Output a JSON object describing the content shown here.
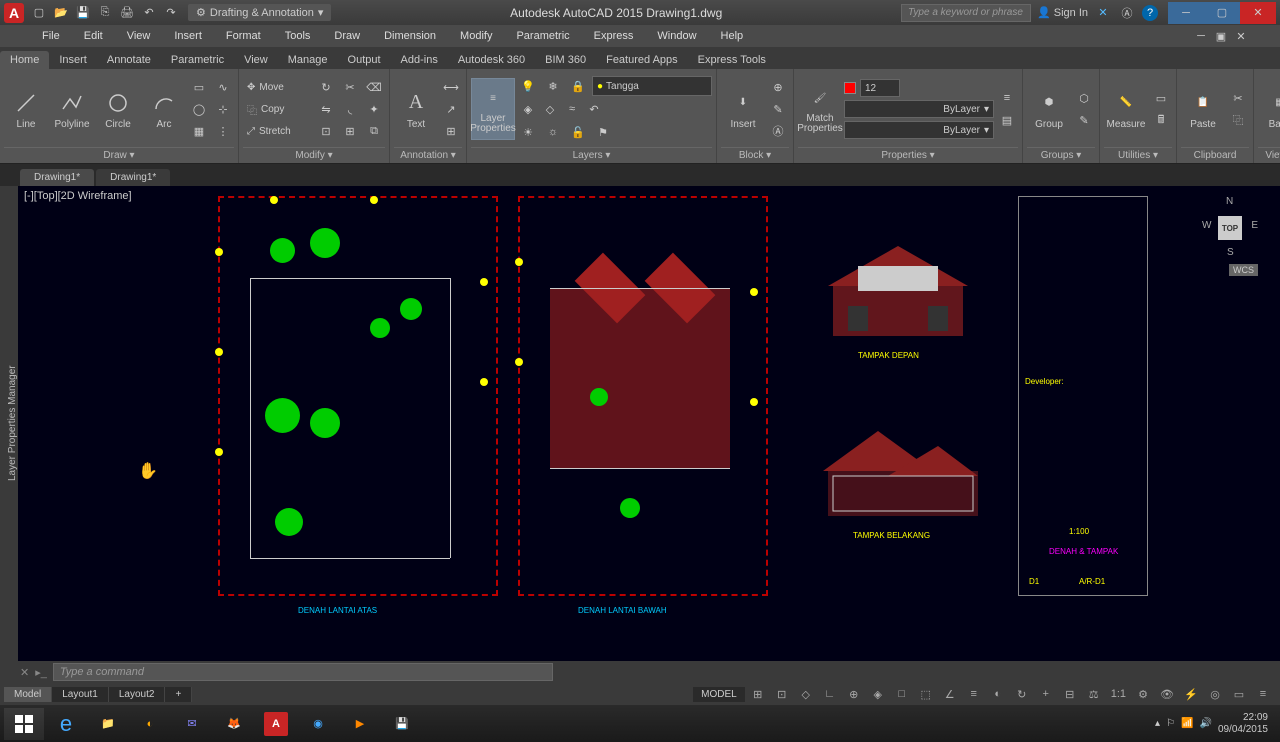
{
  "titlebar": {
    "workspace": "Drafting & Annotation",
    "app_title": "Autodesk AutoCAD 2015   Drawing1.dwg",
    "search_placeholder": "Type a keyword or phrase",
    "signin": "Sign In"
  },
  "menubar": [
    "File",
    "Edit",
    "View",
    "Insert",
    "Format",
    "Tools",
    "Draw",
    "Dimension",
    "Modify",
    "Parametric",
    "Express",
    "Window",
    "Help"
  ],
  "ribbon_tabs": [
    "Home",
    "Insert",
    "Annotate",
    "Parametric",
    "View",
    "Manage",
    "Output",
    "Add-ins",
    "Autodesk 360",
    "BIM 360",
    "Featured Apps",
    "Express Tools"
  ],
  "ribbon": {
    "draw": {
      "title": "Draw ▾",
      "line": "Line",
      "polyline": "Polyline",
      "circle": "Circle",
      "arc": "Arc"
    },
    "modify": {
      "title": "Modify ▾",
      "move": "Move",
      "copy": "Copy",
      "stretch": "Stretch"
    },
    "annotation": {
      "title": "Annotation ▾",
      "text": "Text"
    },
    "layers": {
      "title": "Layers ▾",
      "layerprops": "Layer Properties",
      "current": "Tangga"
    },
    "block": {
      "title": "Block ▾",
      "insert": "Insert"
    },
    "properties": {
      "title": "Properties ▾",
      "match": "Match Properties",
      "lineweight": "12",
      "bylayer1": "ByLayer",
      "bylayer2": "ByLayer"
    },
    "groups": {
      "title": "Groups ▾",
      "group": "Group"
    },
    "utilities": {
      "title": "Utilities ▾",
      "measure": "Measure"
    },
    "clipboard": {
      "title": "Clipboard",
      "paste": "Paste"
    },
    "view": {
      "title": "View ▾",
      "base": "Base"
    }
  },
  "doctabs": [
    "Drawing1*",
    "Drawing1*"
  ],
  "viewport": {
    "label": "[-][Top][2D Wireframe]",
    "cube": "TOP",
    "wcs": "WCS"
  },
  "side_panel": "Layer Properties Manager",
  "drawing_labels": {
    "plan1": "DENAH LANTAI ATAS",
    "plan2": "DENAH LANTAI BAWAH",
    "elev1": "TAMPAK DEPAN",
    "elev2": "TAMPAK BELAKANG",
    "scale": "1:100",
    "sheet": "DENAH & TAMPAK",
    "developer": "Developer:",
    "code1": "D1",
    "code2": "A/R-D1"
  },
  "cmdline": {
    "placeholder": "Type a command"
  },
  "layouttabs": [
    "Model",
    "Layout1",
    "Layout2"
  ],
  "statusbar": {
    "model": "MODEL",
    "scale": "1:1"
  },
  "tray": {
    "time": "22:09",
    "date": "09/04/2015"
  }
}
